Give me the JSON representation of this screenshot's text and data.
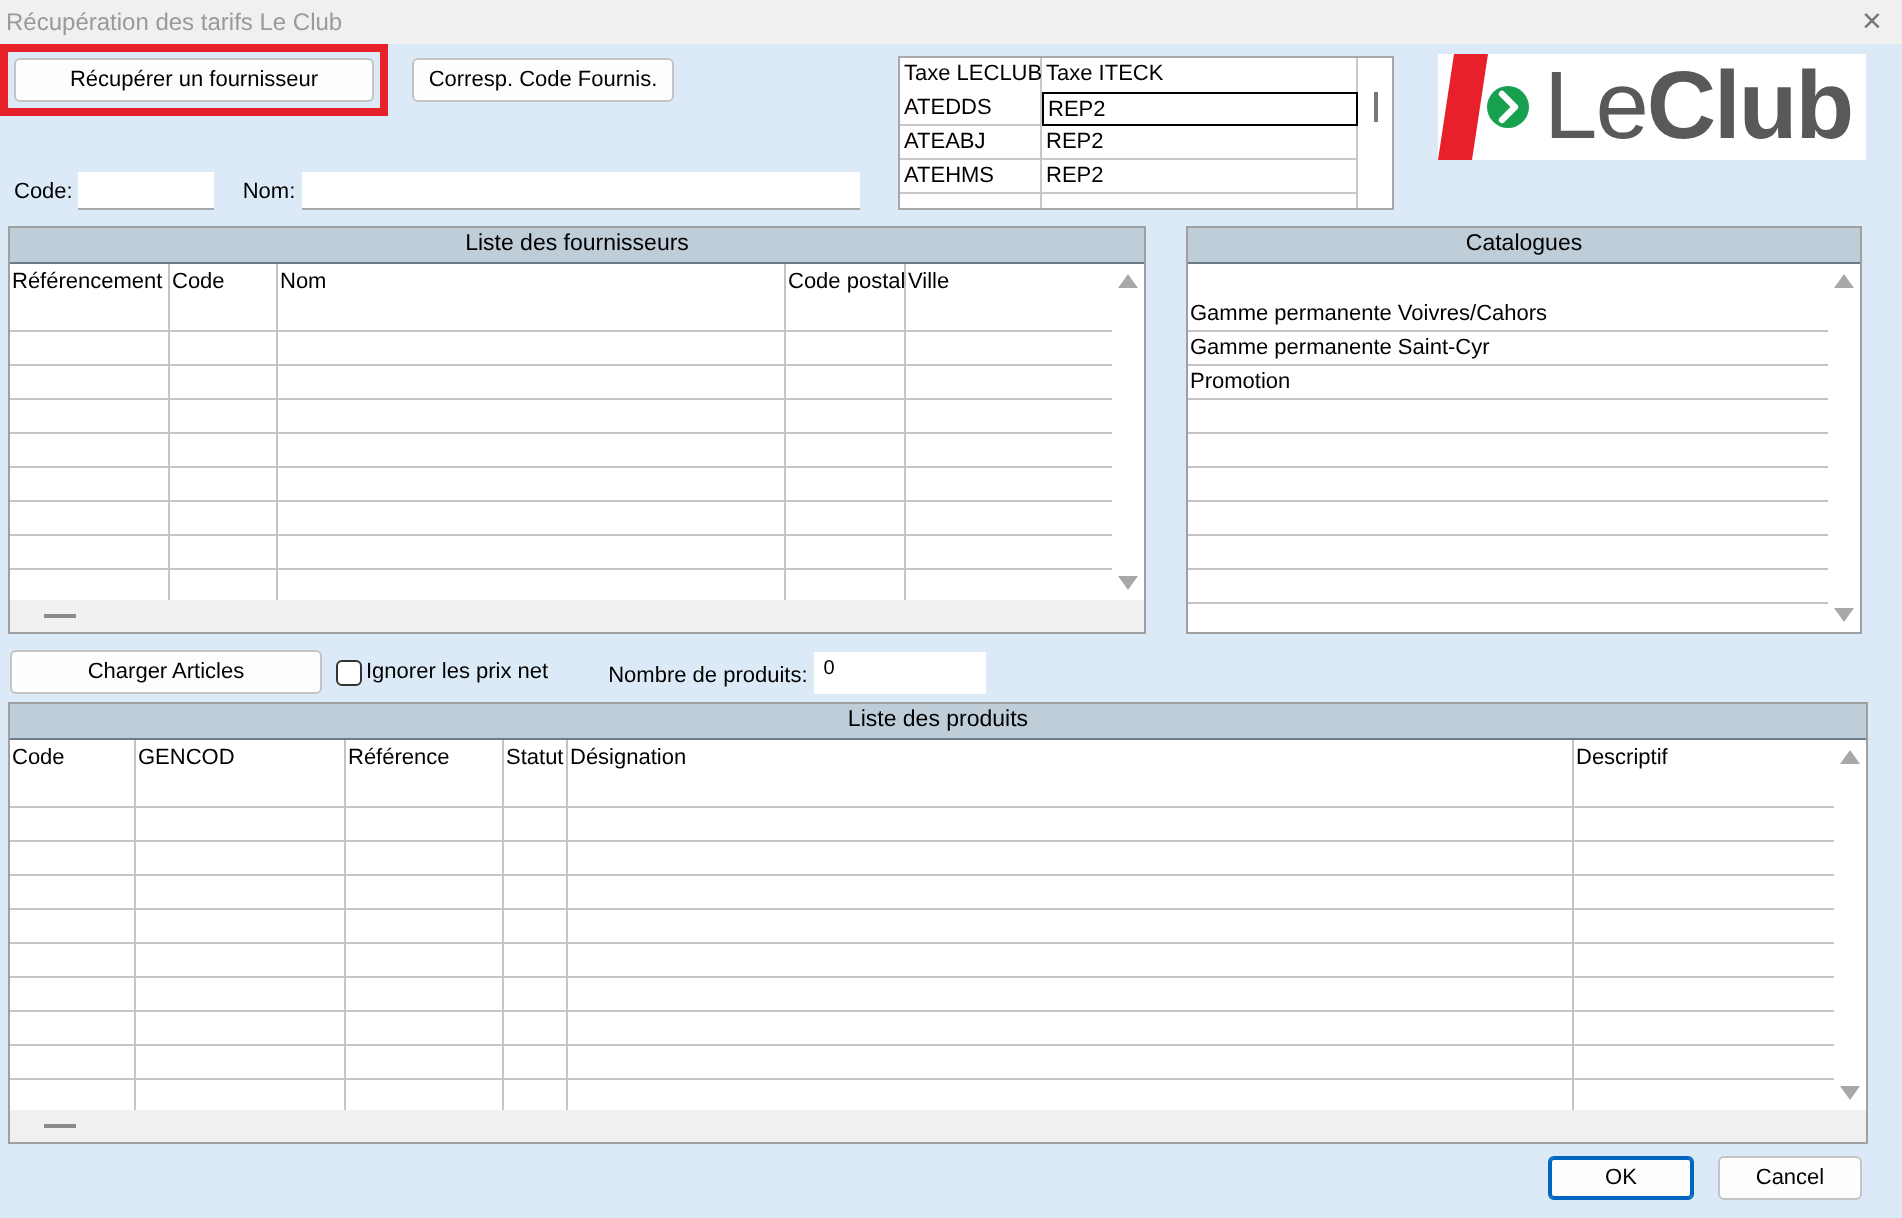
{
  "window": {
    "title": "Récupération des tarifs Le Club",
    "close": "×"
  },
  "top_buttons": [
    {
      "label": "Récupérer un fournisseur",
      "highlighted": true
    },
    {
      "label": "Corresp. Code Fournis.",
      "highlighted": false
    }
  ],
  "filters": [
    {
      "label": "Code:"
    },
    {
      "label": "Nom:"
    }
  ],
  "tax_table": {
    "columns": [
      "Taxe LECLUB",
      "Taxe ITECK"
    ],
    "rows": [
      {
        "cells": [
          "ATEDDS",
          "REP2"
        ],
        "selected": true
      },
      {
        "cells": [
          "ATEABJ",
          "REP2"
        ],
        "selected": false
      },
      {
        "cells": [
          "ATEHMS",
          "REP2"
        ],
        "selected": false
      }
    ]
  },
  "logo": {
    "text": "Le**Club**"
  },
  "suppliers": {
    "title": "Liste des fournisseurs",
    "columns": [
      "Référencement",
      "Code",
      "Nom",
      "Code postal",
      "Ville"
    ]
  },
  "catalogues": {
    "title": "Catalogues",
    "rows": [
      "Gamme permanente Voivres/Cahors",
      "Gamme permanente Saint-Cyr",
      "Promotion"
    ]
  },
  "load_button": {
    "label": "Charger Articles"
  },
  "ignore_net_prices": {
    "label": "Ignorer les prix net",
    "checked": false
  },
  "product_count": {
    "label": "Nombre de produits:",
    "value": "0"
  },
  "products": {
    "title": "Liste des produits",
    "columns": [
      "Code",
      "GENCOD",
      "Référence",
      "Statut",
      "Désignation",
      "Descriptif"
    ]
  },
  "buttons": [
    {
      "label": "OK",
      "default": true
    },
    {
      "label": "Cancel",
      "default": false
    }
  ]
}
